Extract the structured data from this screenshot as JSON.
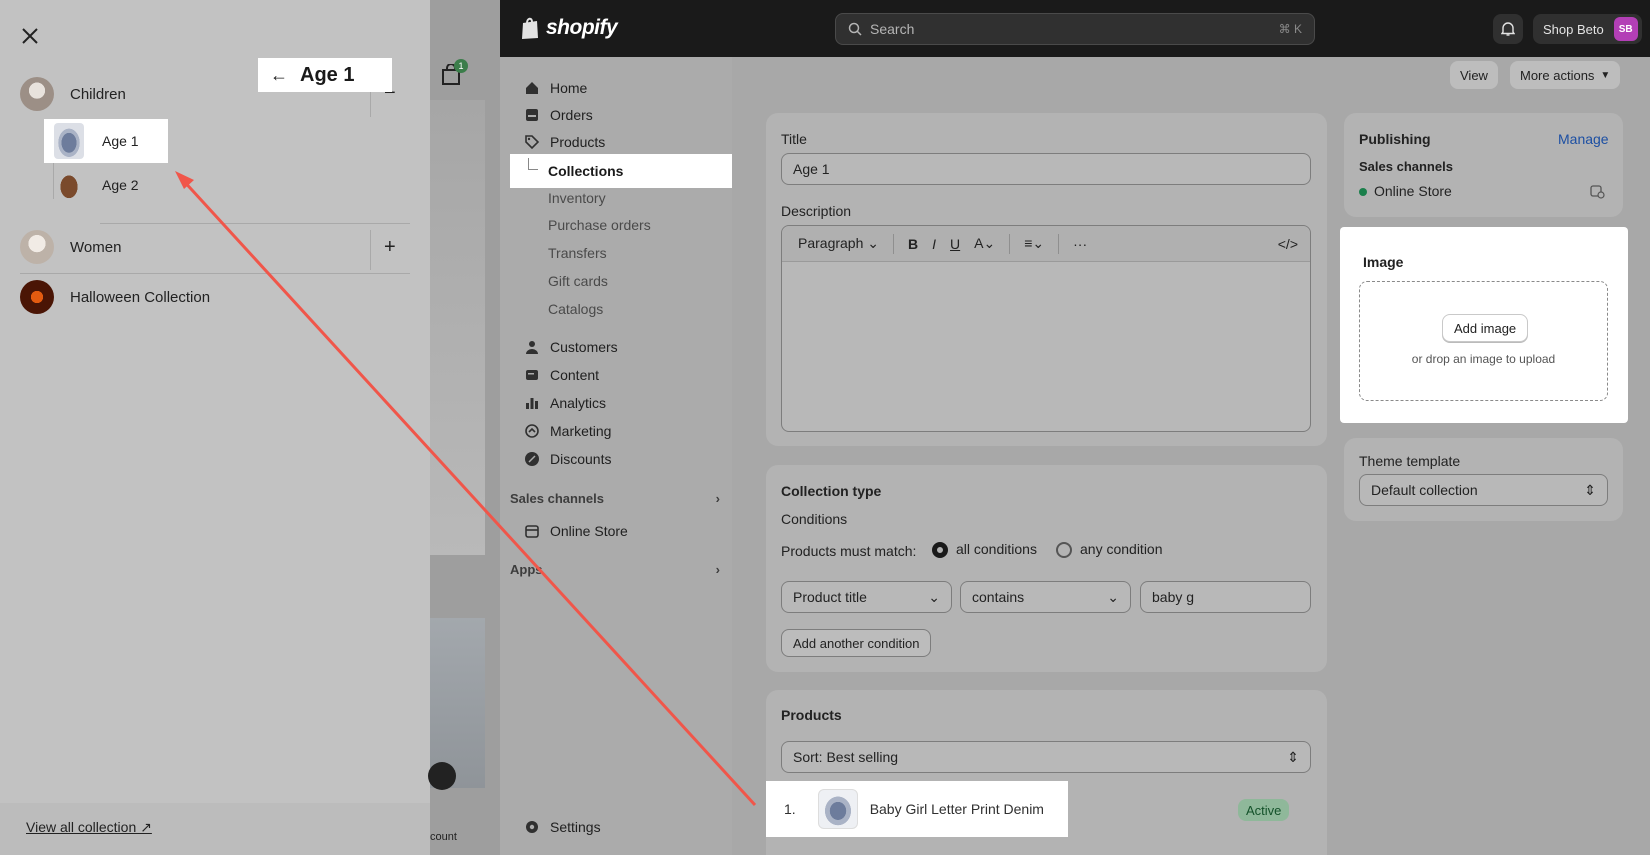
{
  "drawer": {
    "categories": [
      {
        "label": "Children",
        "toggle": "−"
      },
      {
        "label": "Women",
        "toggle": "+"
      },
      {
        "label": "Halloween Collection"
      }
    ],
    "children_sub": [
      {
        "label": "Age 1"
      },
      {
        "label": "Age 2"
      }
    ],
    "view_all": "View all collection ↗"
  },
  "storefront": {
    "cart_count": "1",
    "account_label": "count"
  },
  "topbar": {
    "logo": "shopify",
    "search_placeholder": "Search",
    "search_shortcut": "⌘ K",
    "shop_name": "Shop Beto",
    "shop_initials": "SB"
  },
  "sidebar": {
    "items": [
      {
        "label": "Home"
      },
      {
        "label": "Orders"
      },
      {
        "label": "Products"
      },
      {
        "label": "Collections"
      },
      {
        "label": "Inventory"
      },
      {
        "label": "Purchase orders"
      },
      {
        "label": "Transfers"
      },
      {
        "label": "Gift cards"
      },
      {
        "label": "Catalogs"
      },
      {
        "label": "Customers"
      },
      {
        "label": "Content"
      },
      {
        "label": "Analytics"
      },
      {
        "label": "Marketing"
      },
      {
        "label": "Discounts"
      }
    ],
    "sales_channels_label": "Sales channels",
    "online_store": "Online Store",
    "apps_label": "Apps",
    "settings": "Settings"
  },
  "page": {
    "title": "Age 1",
    "view_button": "View",
    "more_actions": "More actions"
  },
  "details": {
    "title_label": "Title",
    "title_value": "Age 1",
    "description_label": "Description",
    "paragraph": "Paragraph"
  },
  "collection_type": {
    "heading": "Collection type",
    "conditions_label": "Conditions",
    "must_match_label": "Products must match:",
    "all_conditions": "all conditions",
    "any_condition": "any condition",
    "field": "Product title",
    "operator": "contains",
    "value": "baby g",
    "add_condition": "Add another condition"
  },
  "products": {
    "heading": "Products",
    "sort_label": "Sort: Best selling",
    "rows": [
      {
        "index": "1.",
        "name": "Baby Girl Letter Print Denim",
        "status": "Active"
      }
    ]
  },
  "publishing": {
    "heading": "Publishing",
    "manage": "Manage",
    "sales_channels": "Sales channels",
    "online_store": "Online Store",
    "status_color": "#1a7f4b"
  },
  "image_card": {
    "heading": "Image",
    "add_image": "Add image",
    "drop_text": "or drop an image to upload"
  },
  "theme": {
    "heading": "Theme template",
    "value": "Default collection"
  },
  "annotation_color": "#f0564a"
}
